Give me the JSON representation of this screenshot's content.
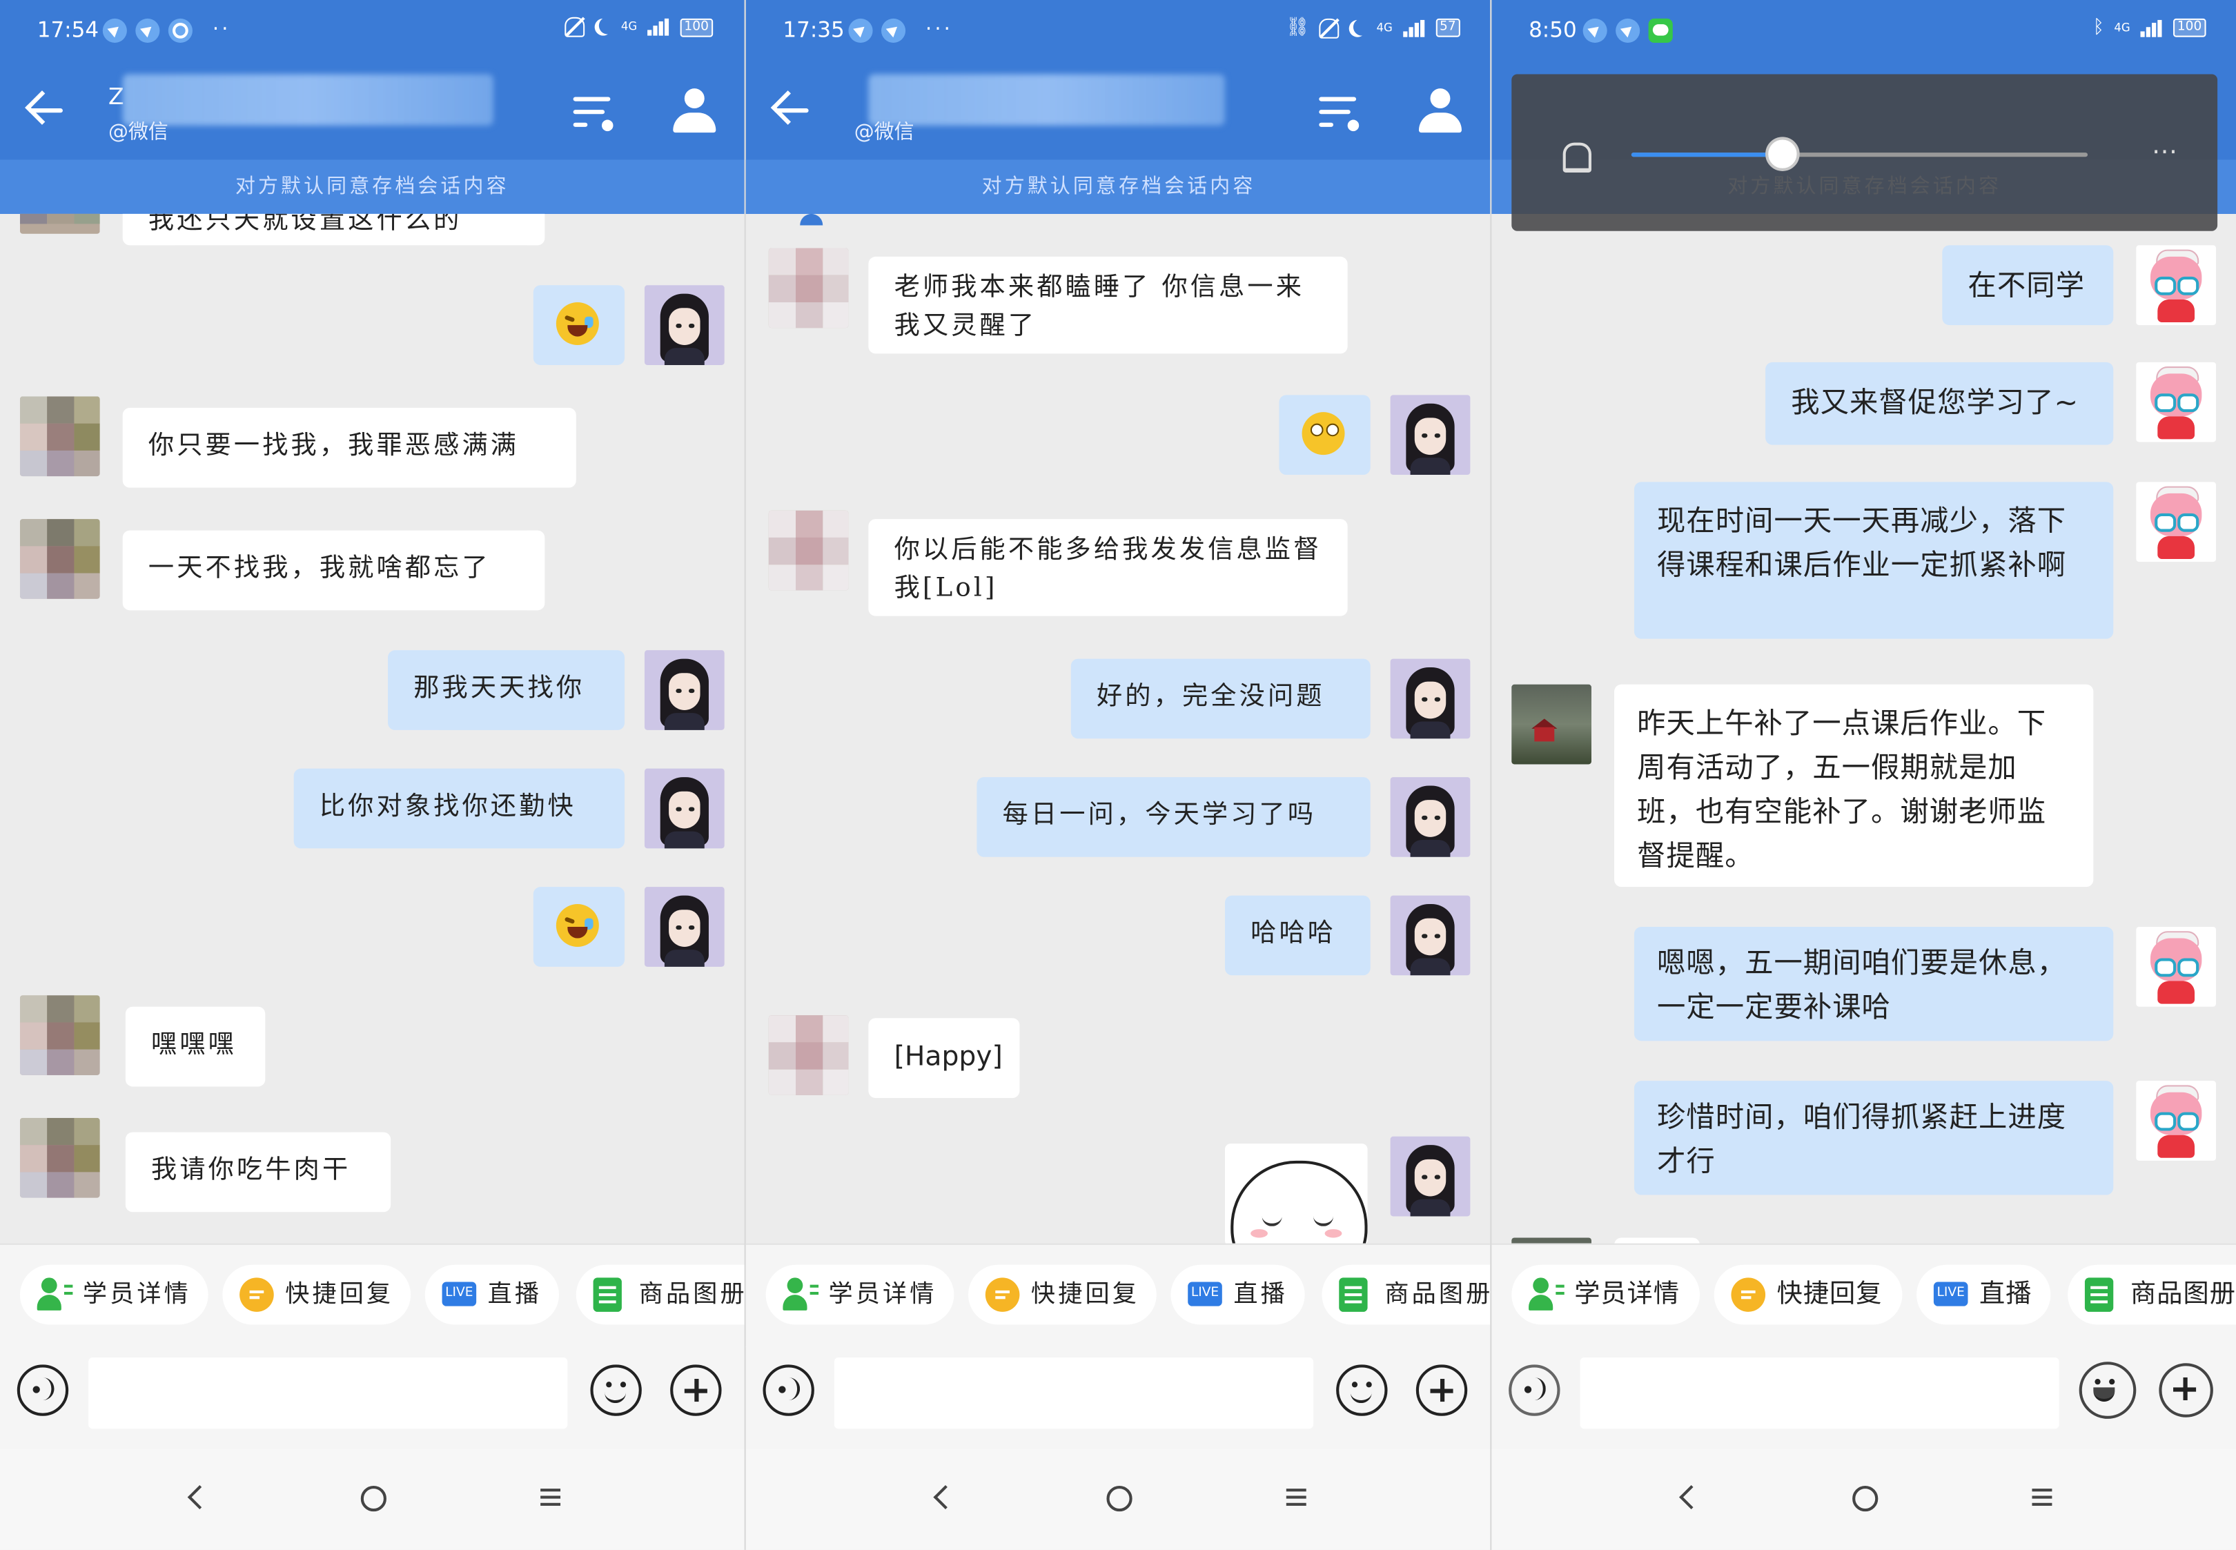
{
  "common": {
    "banner": "对方默认同意存档会话内容",
    "subtitle": "@微信",
    "toolbar": [
      "学员详情",
      "快捷回复",
      "直播",
      "商品图册"
    ],
    "live_badge": "LIVE"
  },
  "phone1": {
    "time": "17:54",
    "battery": "100",
    "name_initial": "Z",
    "network": "4G",
    "messages": {
      "m0": "我还只天就设置这什么的",
      "m3": "你只要一找我，我罪恶感满满",
      "m4": "一天不找我，我就啥都忘了",
      "m5": "那我天天找你",
      "m6": "比你对象找你还勤快",
      "m8": "嘿嘿嘿",
      "m9": "我请你吃牛肉干"
    }
  },
  "phone2": {
    "time": "17:35",
    "battery": "57",
    "network": "4G",
    "messages": {
      "m1": "老师我本来都瞌睡了 你信息一来我又灵醒了",
      "m3": "你以后能不能多给我发发信息监督我[Lol]",
      "m4": "好的，完全没问题",
      "m5": "每日一问，今天学习了吗",
      "m6": "哈哈哈",
      "m7": "[Happy]"
    }
  },
  "phone3": {
    "time": "8:50",
    "battery": "100",
    "network": "4G",
    "volume_level": 0.33,
    "messages": {
      "m1": "在不同学",
      "m2": "我又来督促您学习了~",
      "m3": "现在时间一天一天再减少，落下得课程和课后作业一定抓紧补啊",
      "m4": "昨天上午补了一点课后作业。下周有活动了，五一假期就是加班，也有空能补了。谢谢老师监督提醒。",
      "m5": "嗯嗯，五一期间咱们要是休息，一定一定要补课哈",
      "m6": "珍惜时间，咱们得抓紧赶上进度才行"
    }
  },
  "icons": {
    "back": "back-arrow-icon",
    "list": "list-icon",
    "profile": "person-icon",
    "voice": "voice-icon",
    "emoji": "emoji-icon",
    "plus": "plus-icon"
  },
  "colors": {
    "header": "#3b7bd6",
    "banner": "#4a89e0",
    "bubble_out": "#cfe4fb",
    "bubble_in": "#ffffff",
    "chat_bg": "#ececec"
  }
}
